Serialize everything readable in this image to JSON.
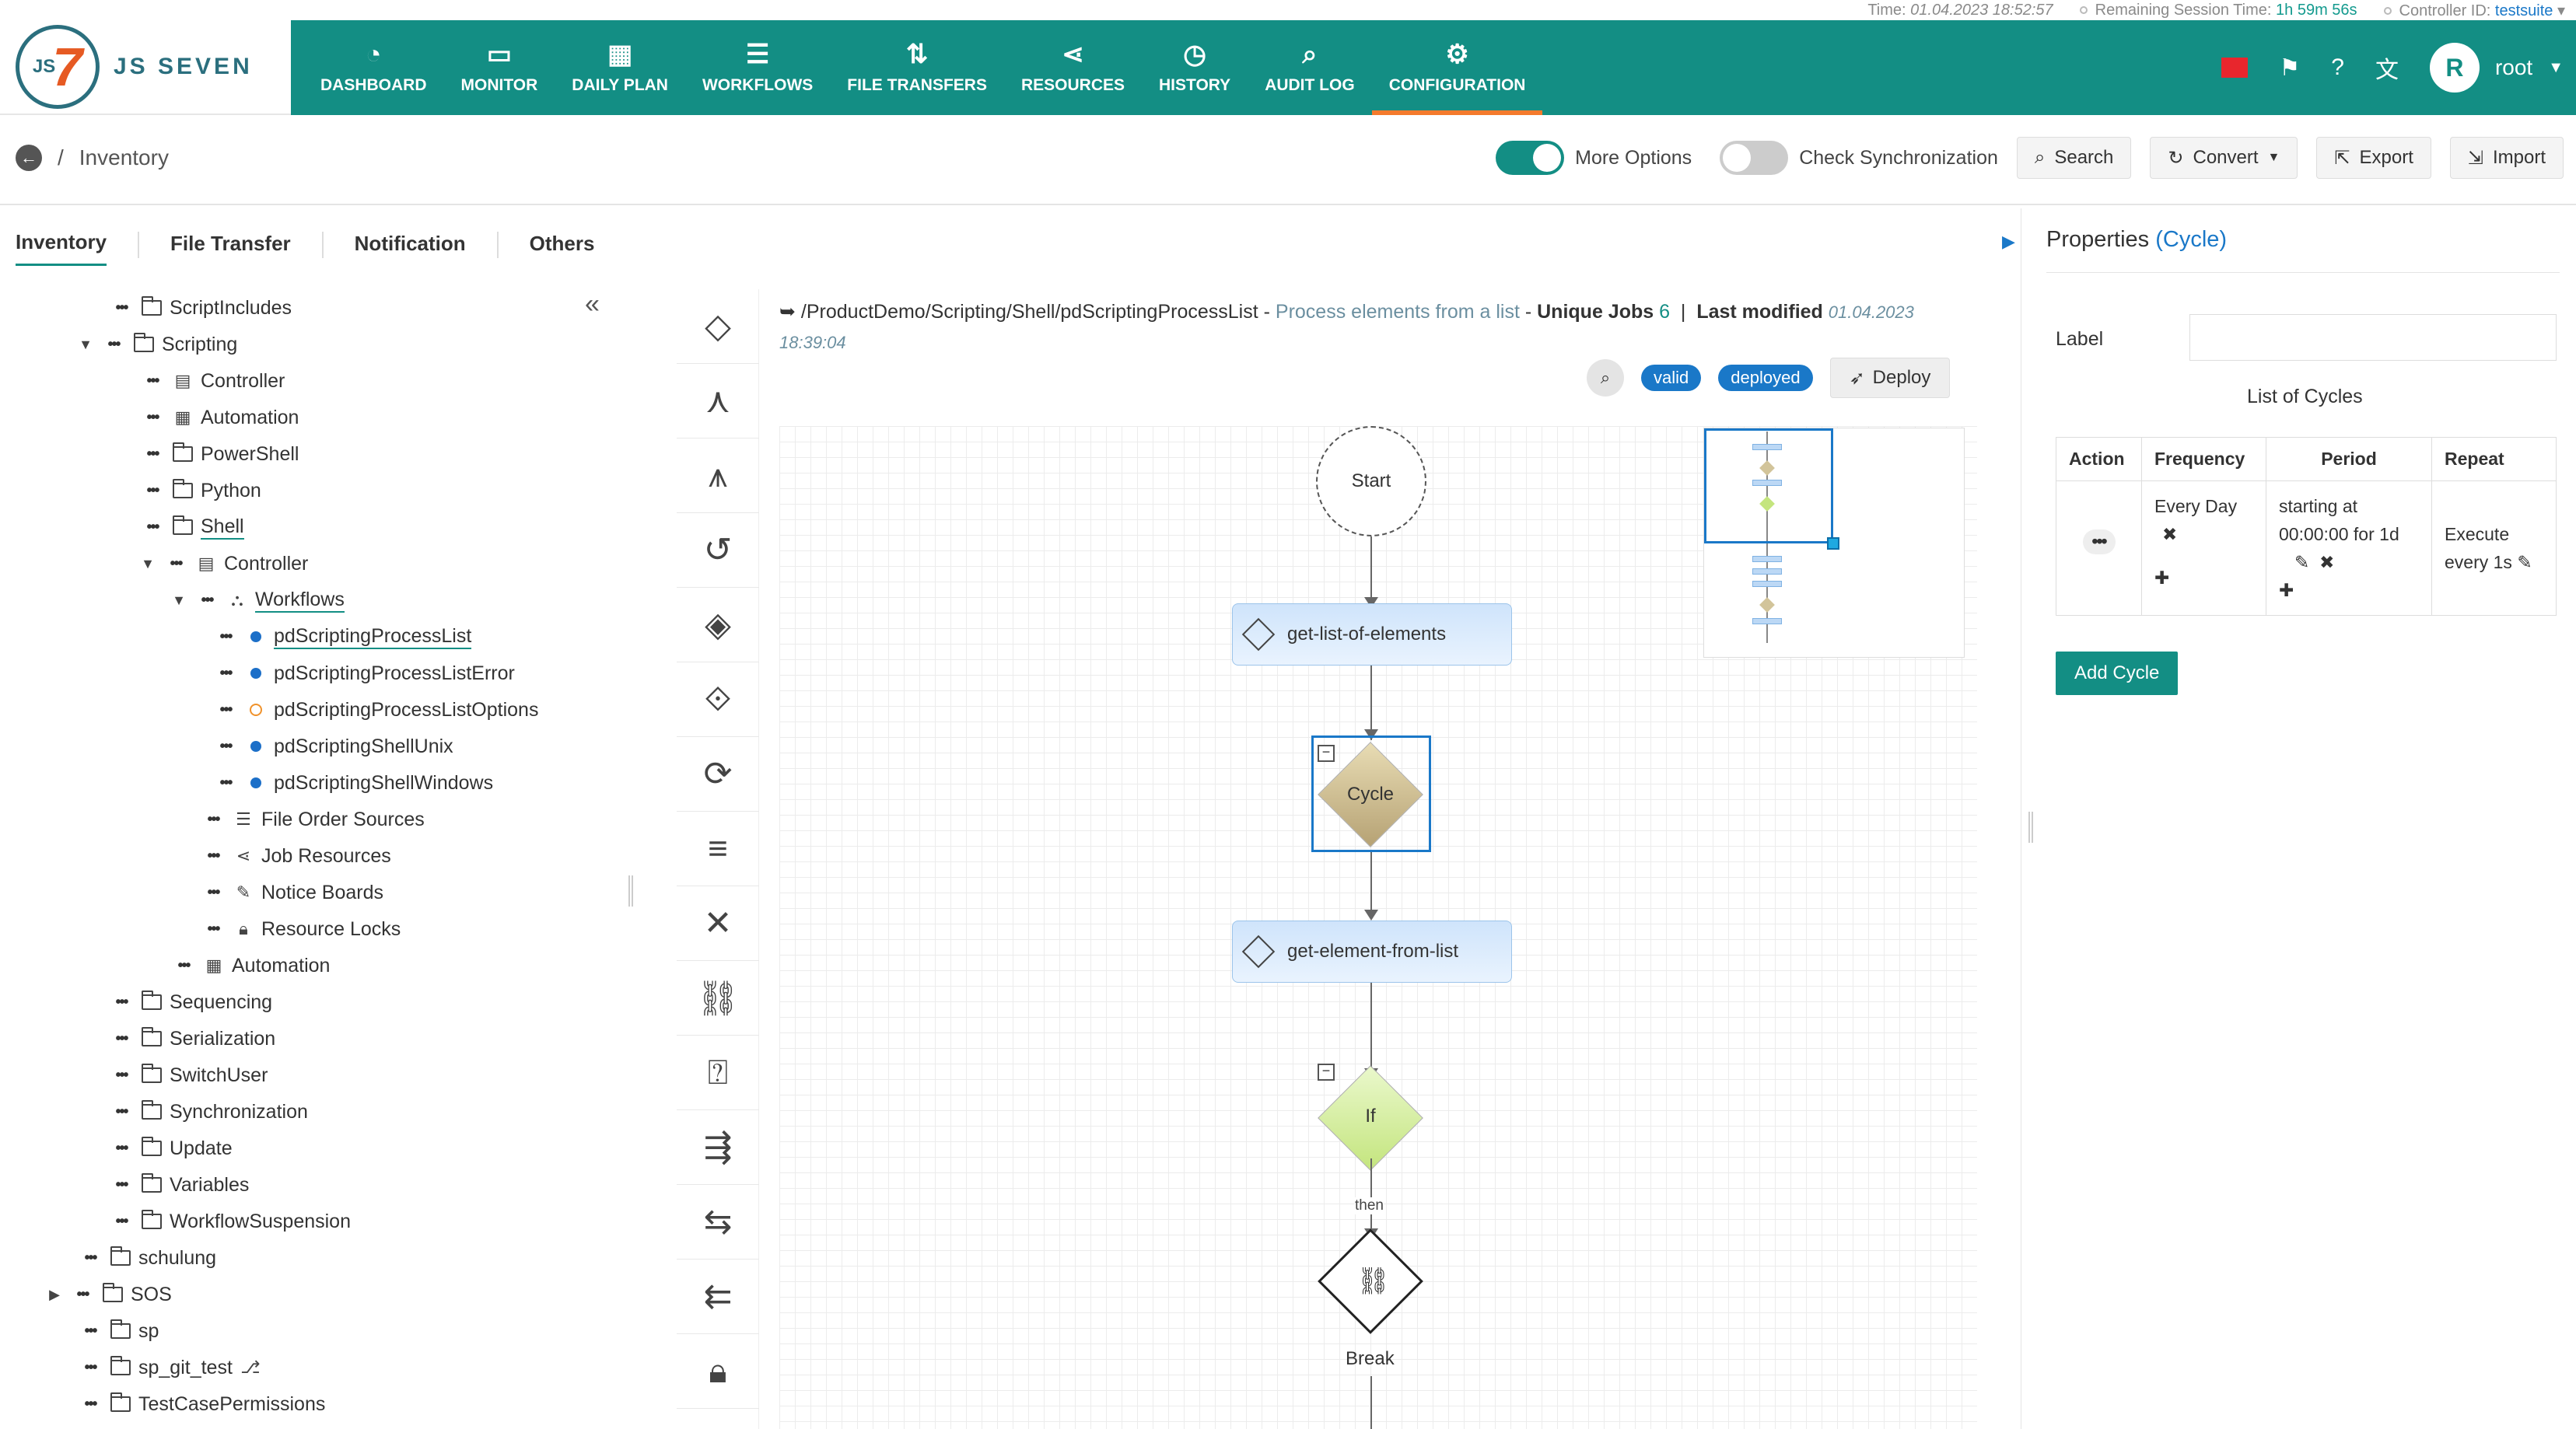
{
  "status_bar": {
    "time_label": "Time:",
    "time_value": "01.04.2023 18:52:57",
    "session_label": "Remaining Session Time:",
    "session_value": "1h 59m 56s",
    "controller_label": "Controller ID:",
    "controller_value": "testsuite"
  },
  "logo": {
    "mark": "JS",
    "text": "JS SEVEN"
  },
  "nav": [
    {
      "label": "DASHBOARD",
      "icon": "gauge-icon"
    },
    {
      "label": "MONITOR",
      "icon": "monitor-icon"
    },
    {
      "label": "DAILY PLAN",
      "icon": "calendar-icon"
    },
    {
      "label": "WORKFLOWS",
      "icon": "workflow-icon"
    },
    {
      "label": "FILE TRANSFERS",
      "icon": "transfer-icon"
    },
    {
      "label": "RESOURCES",
      "icon": "share-icon"
    },
    {
      "label": "HISTORY",
      "icon": "clock-icon"
    },
    {
      "label": "AUDIT LOG",
      "icon": "audit-icon"
    },
    {
      "label": "CONFIGURATION",
      "icon": "gear-icon"
    }
  ],
  "user": {
    "initial": "R",
    "name": "root"
  },
  "breadcrumb": {
    "label": "Inventory"
  },
  "toolbar": {
    "more_options": "More Options",
    "check_sync": "Check Synchronization",
    "search": "Search",
    "convert": "Convert",
    "export": "Export",
    "import": "Import"
  },
  "tabs": [
    "Inventory",
    "File Transfer",
    "Notification",
    "Others"
  ],
  "tree": [
    {
      "label": "ScriptIncludes"
    },
    {
      "label": "Scripting"
    },
    {
      "label": "Controller"
    },
    {
      "label": "Automation"
    },
    {
      "label": "PowerShell"
    },
    {
      "label": "Python"
    },
    {
      "label": "Shell"
    },
    {
      "label": "Controller"
    },
    {
      "label": "Workflows"
    },
    {
      "label": "pdScriptingProcessList"
    },
    {
      "label": "pdScriptingProcessListError"
    },
    {
      "label": "pdScriptingProcessListOptions"
    },
    {
      "label": "pdScriptingShellUnix"
    },
    {
      "label": "pdScriptingShellWindows"
    },
    {
      "label": "File Order Sources"
    },
    {
      "label": "Job Resources"
    },
    {
      "label": "Notice Boards"
    },
    {
      "label": "Resource Locks"
    },
    {
      "label": "Automation"
    },
    {
      "label": "Sequencing"
    },
    {
      "label": "Serialization"
    },
    {
      "label": "SwitchUser"
    },
    {
      "label": "Synchronization"
    },
    {
      "label": "Update"
    },
    {
      "label": "Variables"
    },
    {
      "label": "WorkflowSuspension"
    },
    {
      "label": "schulung"
    },
    {
      "label": "SOS"
    },
    {
      "label": "sp"
    },
    {
      "label": "sp_git_test"
    },
    {
      "label": "TestCasePermissions"
    }
  ],
  "workflow": {
    "path": "/ProductDemo/Scripting/Shell/pdScriptingProcessList",
    "sep1": " - ",
    "title": "Process elements from a list",
    "sep2": " - ",
    "unique_jobs_label": "Unique Jobs",
    "unique_jobs_value": "6",
    "divider": "|",
    "last_modified_label": "Last modified",
    "last_modified_date": "01.04.2023",
    "last_modified_time": "18:39:04",
    "badge_valid": "valid",
    "badge_deployed": "deployed",
    "deploy": "Deploy"
  },
  "graph": {
    "start": "Start",
    "job1": "get-list-of-elements",
    "cycle": "Cycle",
    "job2": "get-element-from-list",
    "if": "If",
    "then": "then",
    "break": "Break"
  },
  "properties": {
    "title": "Properties",
    "type": "(Cycle)",
    "label_field": "Label",
    "label_value": "",
    "list_title": "List of Cycles",
    "headers": [
      "Action",
      "Frequency",
      "Period",
      "Repeat"
    ],
    "row": {
      "frequency": "Every Day",
      "period_line1": "starting at",
      "period_line2": "00:00:00 for 1d",
      "repeat_line1": "Execute",
      "repeat_line2": "every 1s"
    },
    "add_cycle": "Add Cycle"
  },
  "colors": {
    "header": "#138e84",
    "accent": "#f47a2c",
    "badge": "#1a78c8",
    "job_fill": "#cfe4fb",
    "cycle_fill": "#d2c49a",
    "if_fill": "#d7f0a8"
  }
}
